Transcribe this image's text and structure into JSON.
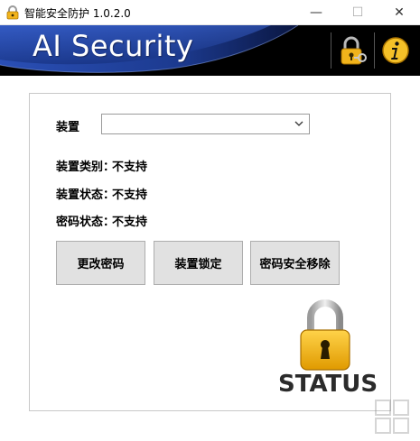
{
  "window": {
    "title": "智能安全防护 1.0.2.0",
    "minimize_glyph": "—",
    "maximize_glyph": "☐",
    "close_glyph": "✕"
  },
  "header": {
    "brand": "AI Security",
    "icons": [
      "lock-key-icon",
      "info-icon"
    ]
  },
  "form": {
    "device_label": "装置",
    "device_value": "",
    "device_type_label": "装置类别：",
    "device_type_value": "不支持",
    "device_status_label": "装置状态：",
    "device_status_value": "不支持",
    "password_status_label": "密码状态：",
    "password_status_value": "不支持"
  },
  "actions": {
    "change_password": "更改密码",
    "lock_device": "装置锁定",
    "secure_remove": "密码安全移除"
  },
  "status": {
    "text": "STATUS",
    "icon": "padlock-icon"
  },
  "colors": {
    "banner_bg": "#000000",
    "banner_wave": "#1e3a8a",
    "lock_gold": "#f2b41b",
    "button_bg": "#e1e1e1"
  }
}
